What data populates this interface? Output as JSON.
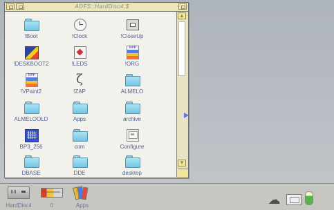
{
  "window": {
    "title": "ADFS::HardDisc4.$"
  },
  "icons": [
    {
      "label": "!Boot",
      "kind": "folder"
    },
    {
      "label": "!Clock",
      "kind": "clock"
    },
    {
      "label": "!CloseUp",
      "kind": "closeup"
    },
    {
      "label": "!DESKBOOT2",
      "kind": "desk"
    },
    {
      "label": "!LEDS",
      "kind": "leds"
    },
    {
      "label": "!ORG",
      "kind": "rpp"
    },
    {
      "label": "!VPaint2",
      "kind": "rpp"
    },
    {
      "label": "!ZAP",
      "kind": "zap"
    },
    {
      "label": "ALMELO",
      "kind": "folder"
    },
    {
      "label": "ALMELOOLD",
      "kind": "folder"
    },
    {
      "label": "Apps",
      "kind": "folder"
    },
    {
      "label": "archive",
      "kind": "folder"
    },
    {
      "label": "BP3_256",
      "kind": "bp3"
    },
    {
      "label": "com",
      "kind": "folder"
    },
    {
      "label": "Configure",
      "kind": "config"
    },
    {
      "label": "DBASE",
      "kind": "folder"
    },
    {
      "label": "DDE",
      "kind": "folder"
    },
    {
      "label": "desktop",
      "kind": "folder"
    }
  ],
  "iconbar": {
    "items": [
      {
        "label": "HardDisc4"
      },
      {
        "label": "0"
      },
      {
        "label": "Apps"
      }
    ]
  }
}
